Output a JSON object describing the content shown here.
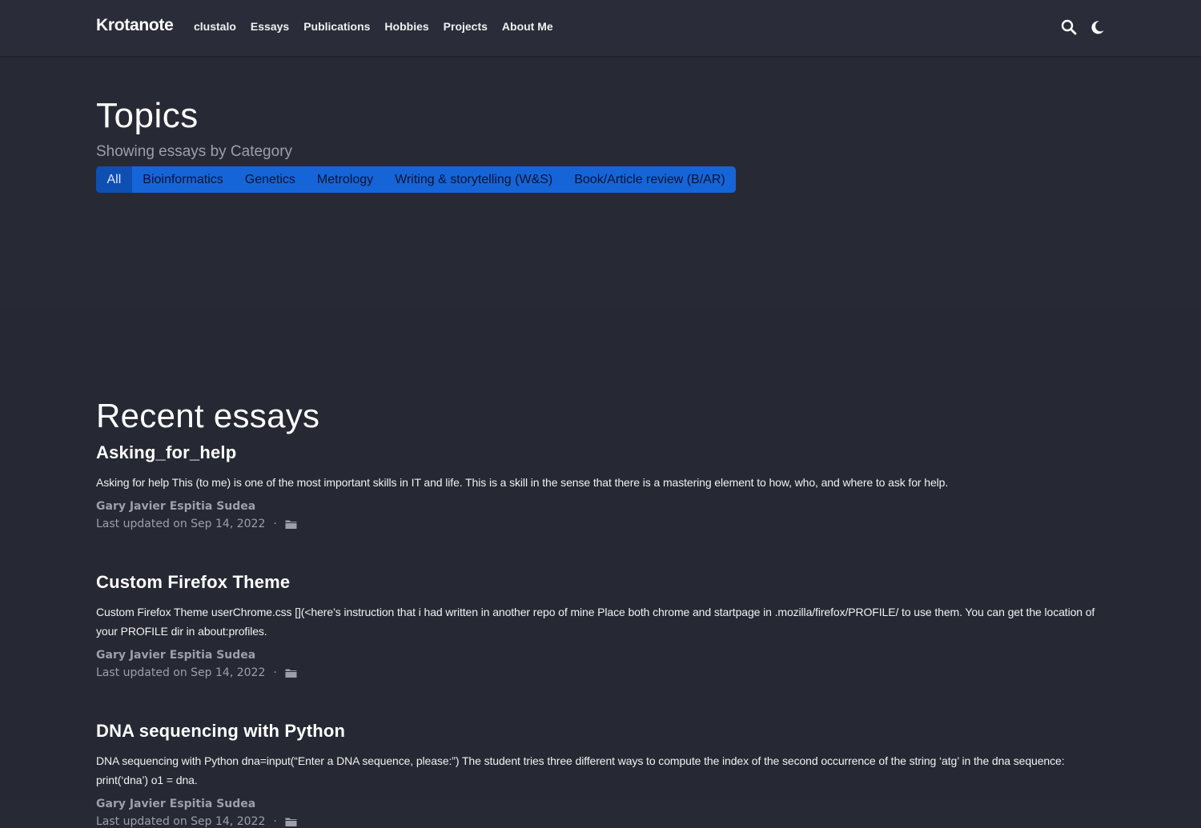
{
  "nav": {
    "brand": "Krotanote",
    "links": [
      "clustalo",
      "Essays",
      "Publications",
      "Hobbies",
      "Projects",
      "About Me"
    ],
    "icons": [
      "search-icon",
      "moon-icon"
    ]
  },
  "hero": {
    "title": "Topics",
    "subtitle": "Showing essays by Category",
    "filters": [
      {
        "label": "All",
        "active": true
      },
      {
        "label": "Bioinformatics",
        "active": false
      },
      {
        "label": "Genetics",
        "active": false
      },
      {
        "label": "Metrology",
        "active": false
      },
      {
        "label": "Writing & storytelling (W&S)",
        "active": false
      },
      {
        "label": "Book/Article review (B/AR)",
        "active": false
      }
    ]
  },
  "recent": {
    "title": "Recent essays",
    "essays": [
      {
        "title": "Asking_for_help",
        "summary": "Asking for help This (to me) is one of the most important skills in IT and life. This is a skill in the sense that there is a mastering element to how, who, and where to ask for help.",
        "author": "Gary Javier Espitia Sudea",
        "updated": "Last updated on Sep 14, 2022",
        "separator": "·"
      },
      {
        "title": "Custom Firefox Theme",
        "summary": "Custom Firefox Theme userChrome.css [](<here’s instruction that i had written in another repo of mine Place both chrome and startpage in .mozilla/firefox/PROFILE/ to use them. You can get the location of your PROFILE dir in about:profiles.",
        "author": "Gary Javier Espitia Sudea",
        "updated": "Last updated on Sep 14, 2022",
        "separator": "·"
      },
      {
        "title": "DNA sequencing with Python",
        "summary": "DNA sequencing with Python dna=input(“Enter a DNA sequence, please:”) The student tries three different ways to compute the index of the second occurrence of the string ‘atg’ in the dna sequence: print(‘dna’) o1 = dna.",
        "author": "Gary Javier Espitia Sudea",
        "updated": "Last updated on Sep 14, 2022",
        "separator": "·"
      }
    ]
  },
  "colors": {
    "background": "#272935",
    "filter_bar": "#1565d8",
    "filter_active": "#0e4fb3",
    "muted_text": "#9ca0ab"
  }
}
